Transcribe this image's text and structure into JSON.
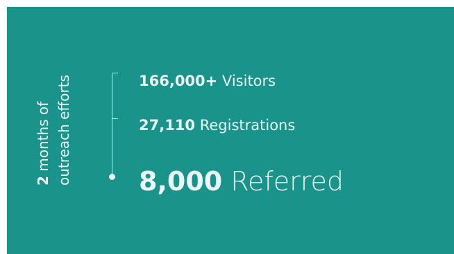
{
  "caption": {
    "line1_bold": "2",
    "line1_rest": " months of",
    "line2": "outreach efforts"
  },
  "stats": [
    {
      "number": "166,000+",
      "label": " Visitors"
    },
    {
      "number": "27,110",
      "label": " Registrations"
    },
    {
      "number": "8,000",
      "label": " Referred"
    }
  ],
  "colors": {
    "background": "#1a938b",
    "text": "#eaf7f6"
  }
}
